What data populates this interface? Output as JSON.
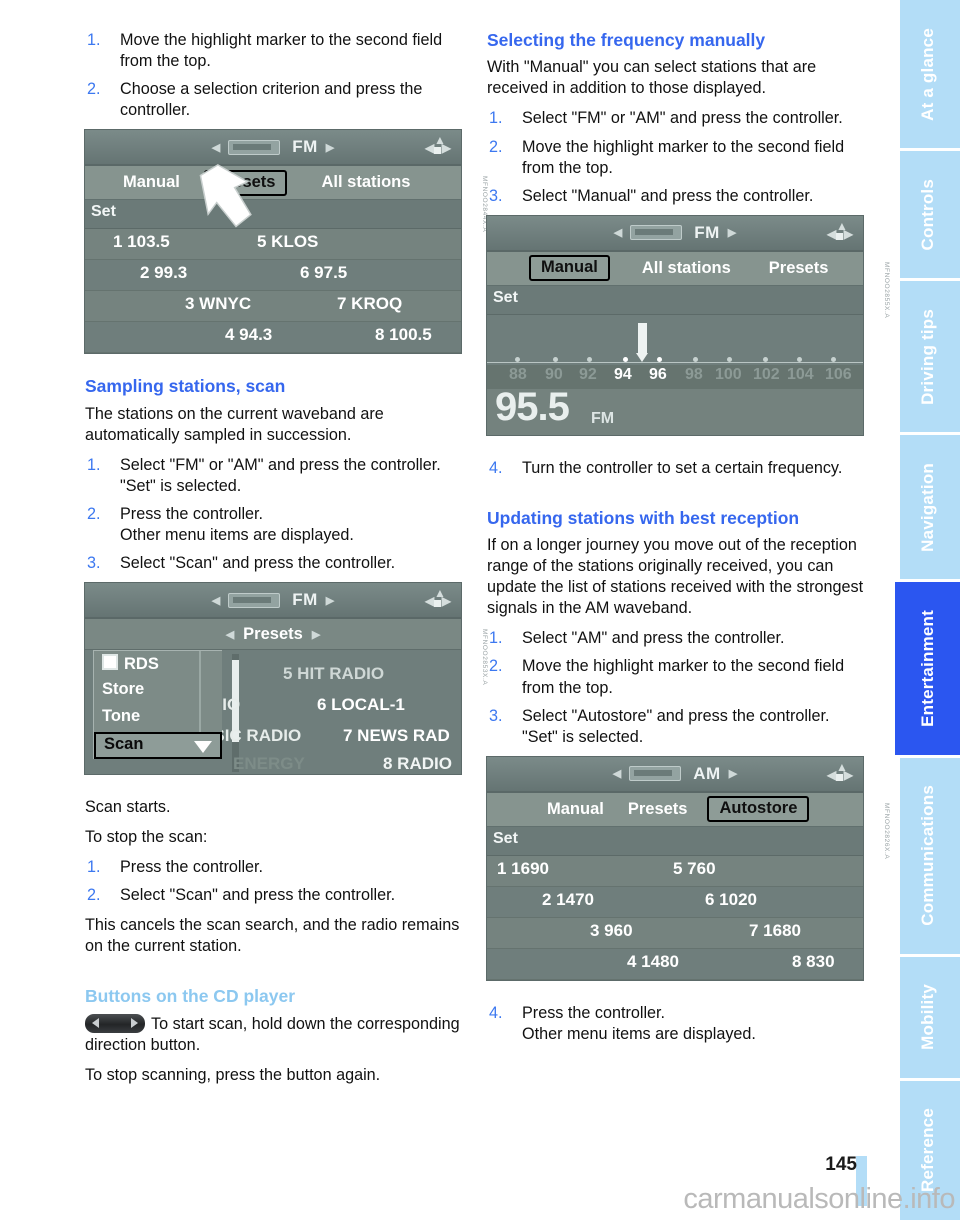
{
  "page": {
    "number": "145",
    "watermark": "carmanualsonline.info"
  },
  "sidebar": {
    "tabs": [
      {
        "label": "At a glance",
        "active": false
      },
      {
        "label": "Controls",
        "active": false
      },
      {
        "label": "Driving tips",
        "active": false
      },
      {
        "label": "Navigation",
        "active": false
      },
      {
        "label": "Entertainment",
        "active": true
      },
      {
        "label": "Communications",
        "active": false
      },
      {
        "label": "Mobility",
        "active": false
      },
      {
        "label": "Reference",
        "active": false
      }
    ],
    "colors": {
      "inactive_bg": "#b3ddf7",
      "active_bg": "#2b56f0",
      "text": "#ffffff"
    }
  },
  "colors": {
    "heading_blue": "#3667ee",
    "heading_light_blue": "#8cc8f0",
    "step_number_blue": "#3c78f0",
    "body_text": "#111111"
  },
  "left_column": {
    "top_steps": [
      {
        "num": "1.",
        "text": "Move the highlight marker to the second field from the top."
      },
      {
        "num": "2.",
        "text": "Choose a selection criterion and press the controller."
      }
    ],
    "figure_presets": {
      "caption": "MFNOO2844X.A",
      "band": "FM",
      "tabs": [
        {
          "label": "Manual",
          "selected": false
        },
        {
          "label": "Presets",
          "selected": true
        },
        {
          "label": "All stations",
          "selected": false
        }
      ],
      "set_label": "Set",
      "rows": [
        {
          "left": "1 103.5",
          "right": "5 KLOS"
        },
        {
          "left": "2 99.3",
          "right": "6 97.5"
        },
        {
          "left": "3 WNYC",
          "right": "7 KROQ"
        },
        {
          "left": "4 94.3",
          "right": "8 100.5"
        }
      ]
    },
    "heading_scan": "Sampling stations, scan",
    "scan_intro": "The stations on the current waveband are automatically sampled in succession.",
    "scan_steps": [
      {
        "num": "1.",
        "text": "Select \"FM\" or \"AM\" and press the controller.",
        "sub": "\"Set\" is selected."
      },
      {
        "num": "2.",
        "text": "Press the controller.",
        "sub": "Other menu items are displayed."
      },
      {
        "num": "3.",
        "text": "Select \"Scan\" and press the controller.",
        "sub": ""
      }
    ],
    "figure_scan": {
      "caption": "MFNOO2853X.A",
      "band": "FM",
      "subtitle": "Presets",
      "menu": [
        {
          "label": "RDS",
          "checkbox": true,
          "selected": false
        },
        {
          "label": "Store",
          "checkbox": false,
          "selected": false
        },
        {
          "label": "Tone",
          "checkbox": false,
          "selected": false
        },
        {
          "label": "Scan",
          "checkbox": false,
          "selected": true
        }
      ],
      "presets_behind": [
        "5 HIT RADIO",
        "R  DIO",
        "6 LOCAL-1",
        "A  SIC RADIO",
        "7 NEWS RAD",
        "ENERGY",
        "8 RADIO"
      ]
    },
    "after_scan_1": "Scan starts.",
    "after_scan_2": "To stop the scan:",
    "stop_steps": [
      {
        "num": "1.",
        "text": "Press the controller."
      },
      {
        "num": "2.",
        "text": "Select \"Scan\" and press the controller."
      }
    ],
    "after_scan_3": "This cancels the scan search, and the radio remains on the current station.",
    "heading_cd": "Buttons on the CD player",
    "cd_text": "To start scan, hold down the corresponding direction button.",
    "cd_text_2": "To stop scanning, press the button again."
  },
  "right_column": {
    "heading_manual": "Selecting the frequency manually",
    "manual_intro": "With \"Manual\" you can select stations that are received in addition to those displayed.",
    "manual_steps": [
      {
        "num": "1.",
        "text": "Select \"FM\" or \"AM\" and press the controller."
      },
      {
        "num": "2.",
        "text": "Move the highlight marker to the second field from the top."
      },
      {
        "num": "3.",
        "text": "Select \"Manual\" and press the controller."
      }
    ],
    "figure_manual": {
      "caption": "MFNOO2855X.A",
      "band": "FM",
      "tabs": [
        {
          "label": "Manual",
          "selected": true
        },
        {
          "label": "All stations",
          "selected": false
        },
        {
          "label": "Presets",
          "selected": false
        }
      ],
      "set_label": "Set",
      "dial_labels": [
        "88",
        "90",
        "92",
        "94",
        "96",
        "98",
        "100",
        "102",
        "104",
        "106"
      ],
      "dial_highlight": [
        "94",
        "96"
      ],
      "frequency": "95.5",
      "frequency_unit": "FM"
    },
    "step_4": {
      "num": "4.",
      "text": "Turn the controller to set a certain frequency."
    },
    "heading_update": "Updating stations with best reception",
    "update_intro": "If on a longer journey you move out of the reception range of the stations originally received, you can update the list of stations received with the strongest signals in the AM waveband.",
    "update_steps": [
      {
        "num": "1.",
        "text": "Select \"AM\" and press the controller.",
        "sub": ""
      },
      {
        "num": "2.",
        "text": "Move the highlight marker to the second field from the top.",
        "sub": ""
      },
      {
        "num": "3.",
        "text": "Select \"Autostore\" and press the controller.",
        "sub": "\"Set\" is selected."
      }
    ],
    "figure_autostore": {
      "caption": "MFNOO2826X.A",
      "band": "AM",
      "tabs": [
        {
          "label": "Manual",
          "selected": false
        },
        {
          "label": "Presets",
          "selected": false
        },
        {
          "label": "Autostore",
          "selected": true
        }
      ],
      "set_label": "Set",
      "rows": [
        {
          "left": "1 1690",
          "right": "5 760"
        },
        {
          "left": "2 1470",
          "right": "6 1020"
        },
        {
          "left": "3 960",
          "right": "7 1680"
        },
        {
          "left": "4 1480",
          "right": "8 830"
        }
      ]
    },
    "final_step": {
      "num": "4.",
      "text": "Press the controller.",
      "sub": "Other menu items are displayed."
    }
  }
}
